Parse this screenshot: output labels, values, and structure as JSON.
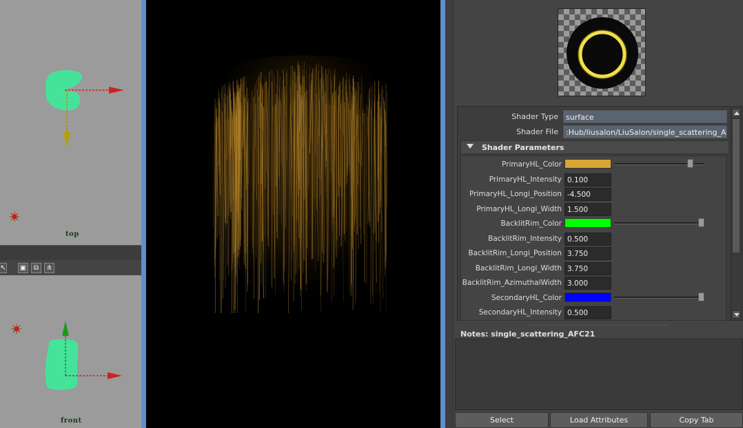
{
  "viewports": {
    "top_label": "top",
    "front_label": "front"
  },
  "shader": {
    "type_label": "Shader Type",
    "type_value": "surface",
    "file_label": "Shader File",
    "file_value": ":Hub/liusalon/LiuSalon/single_scattering_AFC.sdl"
  },
  "section": {
    "title": "Shader Parameters"
  },
  "params": [
    {
      "label": "PrimaryHL_Color",
      "kind": "color",
      "color": "#d9a634",
      "slider": 0.85
    },
    {
      "label": "PrimaryHL_Intensity",
      "kind": "number",
      "value": "0.100"
    },
    {
      "label": "PrimaryHL_Longi_Position",
      "kind": "number",
      "value": "-4.500"
    },
    {
      "label": "PrimaryHL_Longi_Width",
      "kind": "number",
      "value": "1.500"
    },
    {
      "label": "BacklitRim_Color",
      "kind": "color",
      "color": "#00ff00",
      "slider": 0.98
    },
    {
      "label": "BacklitRim_Intensity",
      "kind": "number",
      "value": "0.500"
    },
    {
      "label": "BacklitRim_Longi_Position",
      "kind": "number",
      "value": "3.750"
    },
    {
      "label": "BacklitRim_Longi_Width",
      "kind": "number",
      "value": "3.750"
    },
    {
      "label": "BacklitRim_AzimuthalWidth",
      "kind": "number",
      "value": "3.000"
    },
    {
      "label": "SecondaryHL_Color",
      "kind": "color",
      "color": "#0000ff",
      "slider": 0.98
    },
    {
      "label": "SecondaryHL_Intensity",
      "kind": "number",
      "value": "0.500"
    }
  ],
  "notes": {
    "label": "Notes:  single_scattering_AFC21"
  },
  "buttons": {
    "select": "Select",
    "load": "Load Attributes",
    "copy": "Copy Tab"
  },
  "colors": {
    "viewport_border": "#5f8fc9",
    "mesh": "#45e39a",
    "hair": "#b8862a"
  }
}
